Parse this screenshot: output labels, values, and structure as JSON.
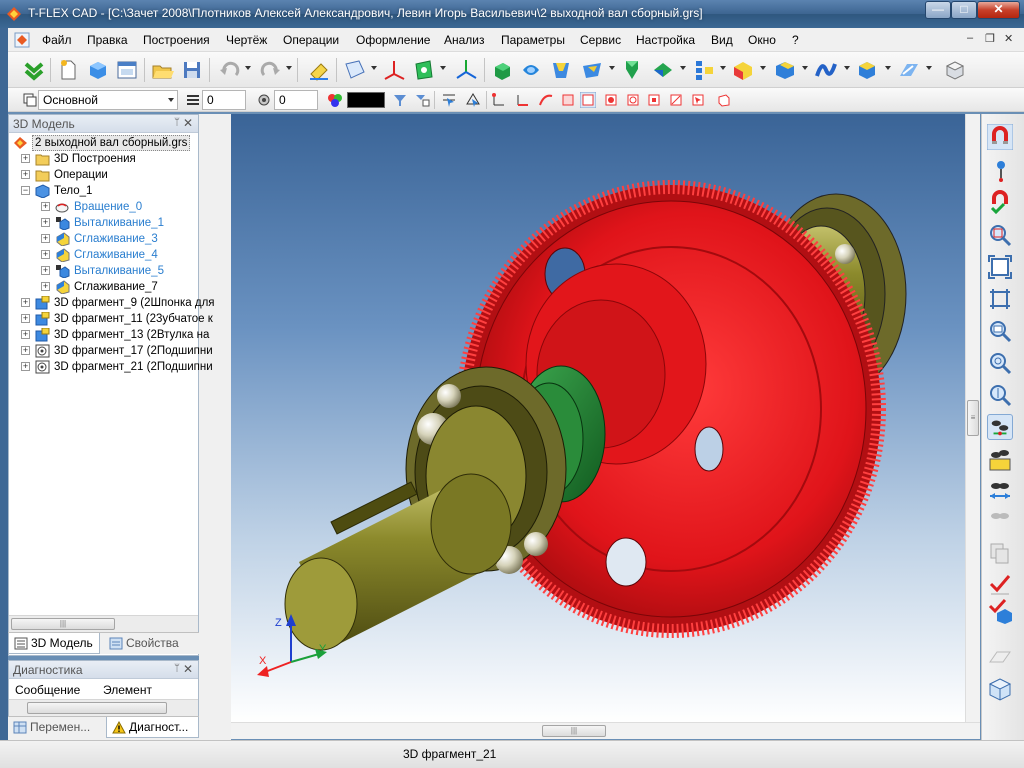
{
  "window": {
    "app_name": "T-FLEX CAD",
    "title": "T-FLEX CAD - [C:\\Зачет 2008\\Плотников Алексей Александрович, Левин Игорь Васильевич\\2 выходной вал сборный.grs]",
    "minimize": "—",
    "maximize": "□",
    "close": "✕"
  },
  "menu": {
    "items": [
      "Файл",
      "Правка",
      "Построения",
      "Чертёж",
      "Операции",
      "Оформление",
      "Анализ",
      "Параметры",
      "Сервис",
      "Настройка",
      "Вид",
      "Окно",
      "?"
    ],
    "mdi_min": "–",
    "mdi_restore": "❐",
    "mdi_close": "✕"
  },
  "toolbar2": {
    "layer_value": "Основной",
    "level_value": "0",
    "priority_value": "0",
    "color_swatch": "#000000"
  },
  "left_panel": {
    "title": "3D Модель",
    "pin": "ᛘ",
    "close": "✕",
    "tree": [
      {
        "label": "2 выходной вал сборный.grs",
        "icon": "model-file-icon",
        "level": 0,
        "expander": "",
        "color": "normal",
        "selected": true
      },
      {
        "label": "3D Построения",
        "icon": "folder-icon",
        "level": 1,
        "expander": "+",
        "color": "normal"
      },
      {
        "label": "Операции",
        "icon": "folder-icon",
        "level": 1,
        "expander": "+",
        "color": "normal"
      },
      {
        "label": "Тело_1",
        "icon": "body-icon",
        "level": 1,
        "expander": "−",
        "color": "normal"
      },
      {
        "label": "Вращение_0",
        "icon": "rotation-icon",
        "level": 2,
        "expander": "+",
        "color": "blue"
      },
      {
        "label": "Выталкивание_1",
        "icon": "extrusion-icon",
        "level": 2,
        "expander": "+",
        "color": "blue"
      },
      {
        "label": "Сглаживание_3",
        "icon": "smoothing-icon",
        "level": 2,
        "expander": "+",
        "color": "blue"
      },
      {
        "label": "Сглаживание_4",
        "icon": "smoothing-icon",
        "level": 2,
        "expander": "+",
        "color": "blue"
      },
      {
        "label": "Выталкивание_5",
        "icon": "extrusion-icon",
        "level": 2,
        "expander": "+",
        "color": "blue"
      },
      {
        "label": "Сглаживание_7",
        "icon": "smoothing-icon",
        "level": 2,
        "expander": "+",
        "color": "normal"
      },
      {
        "label": "3D фрагмент_9 (2Шпонка для",
        "icon": "fragment-icon",
        "level": 1,
        "expander": "+",
        "color": "normal"
      },
      {
        "label": "3D фрагмент_11 (23убчатое к",
        "icon": "fragment-icon",
        "level": 1,
        "expander": "+",
        "color": "normal"
      },
      {
        "label": "3D фрагмент_13 (2Втулка на",
        "icon": "fragment-icon",
        "level": 1,
        "expander": "+",
        "color": "normal"
      },
      {
        "label": "3D фрагмент_17 (2Подшипни",
        "icon": "bearing-fragment-icon",
        "level": 1,
        "expander": "+",
        "color": "normal"
      },
      {
        "label": "3D фрагмент_21 (2Подшипни",
        "icon": "bearing-fragment-icon",
        "level": 1,
        "expander": "+",
        "color": "normal"
      }
    ],
    "scroll_grip": "|||"
  },
  "panel_tabs": {
    "model_tab": "3D Модель",
    "properties_tab": "Свойства"
  },
  "diag_panel": {
    "title": "Диагностика",
    "pin": "ᛘ",
    "close": "✕",
    "col_message": "Сообщение",
    "col_element": "Элемент"
  },
  "bottom_tabs": {
    "variables_tab": "Перемен...",
    "diagnostics_tab": "Диагност..."
  },
  "viewport": {
    "axis_x": "X",
    "axis_y": "Y",
    "axis_z": "Z",
    "colors": {
      "gear": "#e8161b",
      "shaft": "#7b7a1c",
      "bushing": "#1f7a2c",
      "bearing": "#6d6a2a",
      "ball": "#d9d7c2"
    },
    "hscroll_grip": "|||",
    "vscroll_grip": "≡"
  },
  "status": {
    "text": "3D фрагмент_21"
  }
}
